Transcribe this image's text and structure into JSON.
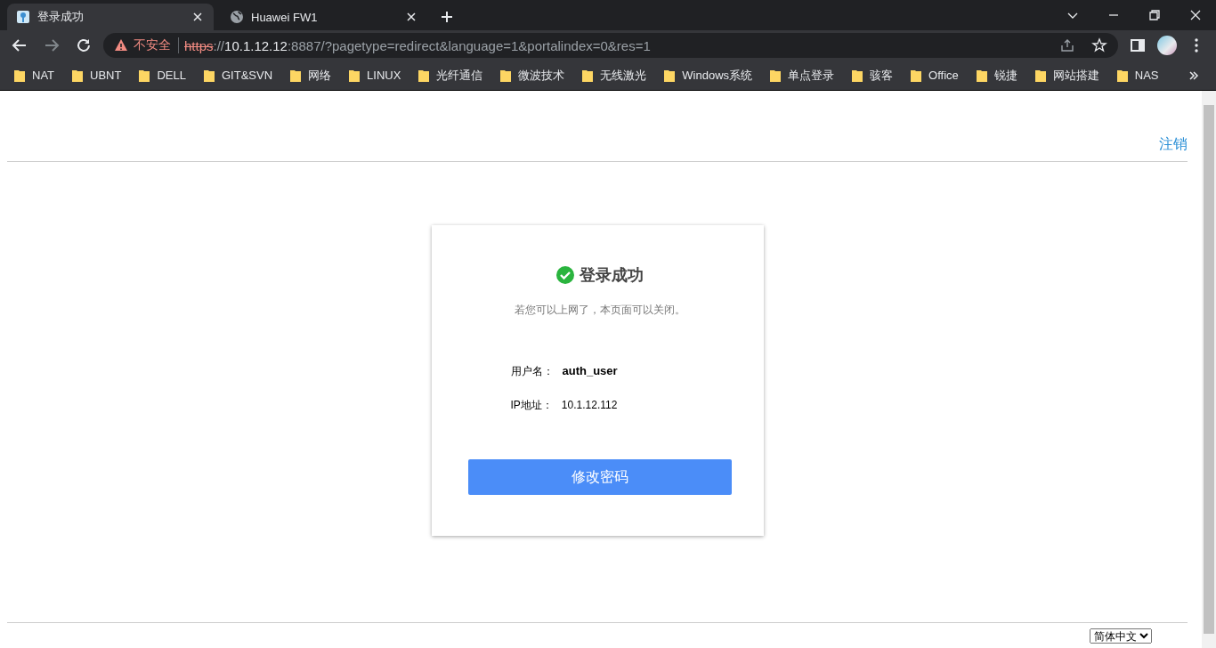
{
  "tabs": [
    {
      "title": "登录成功",
      "selected": true,
      "kind": "key"
    },
    {
      "title": "Huawei FW1",
      "selected": false,
      "kind": "globe"
    }
  ],
  "address_bar": {
    "security_label": "不安全",
    "segments": [
      {
        "text": "https",
        "kind": "insecure-scheme"
      },
      {
        "text": "://",
        "kind": "dim"
      },
      {
        "text": "10.1.12.12",
        "kind": "host"
      },
      {
        "text": ":8887/?pagetype=redirect&language=1&portalindex=0&res=1",
        "kind": "dim"
      }
    ]
  },
  "bookmarks": [
    "NAT",
    "UBNT",
    "DELL",
    "GIT&SVN",
    "网络",
    "LINUX",
    "光纤通信",
    "微波技术",
    "无线激光",
    "Windows系统",
    "单点登录",
    "骇客",
    "Office",
    "锐捷",
    "网站搭建",
    "NAS"
  ],
  "page": {
    "logout_link": "注销",
    "card": {
      "title": "登录成功",
      "message": "若您可以上网了，本页面可以关闭。",
      "fields": [
        {
          "label": "用户名：",
          "value": "auth_user",
          "bold": true
        },
        {
          "label": "IP地址：",
          "value": "10.1.12.112",
          "bold": false
        }
      ],
      "button": "修改密码"
    },
    "language_select": "简体中文"
  }
}
